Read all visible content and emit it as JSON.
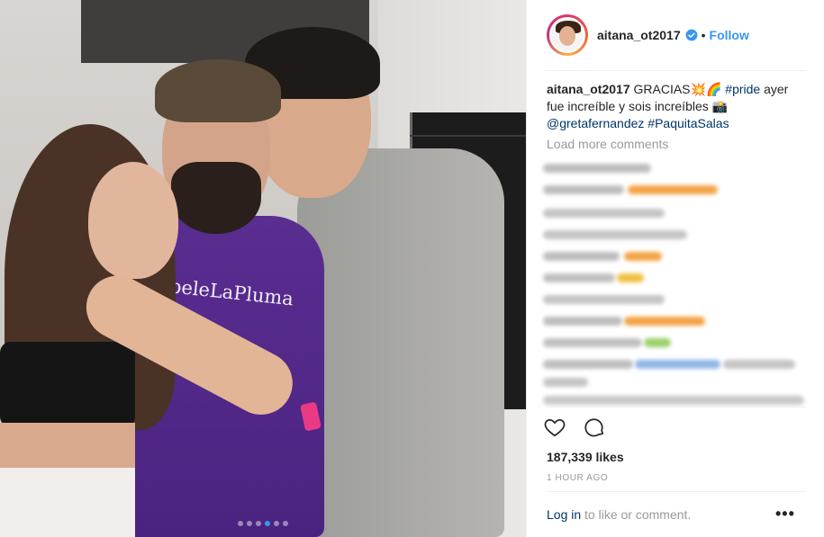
{
  "post": {
    "username": "aitana_ot2017",
    "verified": true,
    "follow_label": "Follow",
    "separator": "•",
    "caption": {
      "author": "aitana_ot2017",
      "text_before": "GRACIAS",
      "emoji_1": "💥🌈",
      "hashtag_1": "#pride",
      "text_middle": "ayer fue increíble y sois increíbles",
      "emoji_2": "📸",
      "mention": "@gretafernandez",
      "hashtag_2": "#PaquitaSalas"
    },
    "load_more_label": "Load more comments",
    "likes_label": "187,339 likes",
    "time_label": "1 HOUR AGO",
    "login_link": "Log in",
    "login_suffix": "to like or comment.",
    "more_label": "•••"
  },
  "photo": {
    "shirt_text": "SúbeleLaPluma",
    "carousel_total": 6,
    "carousel_active": 4
  },
  "colors": {
    "link_blue": "#3897f0",
    "tag_dark_blue": "#003569",
    "muted_gray": "#999999",
    "text_dark": "#262626"
  }
}
